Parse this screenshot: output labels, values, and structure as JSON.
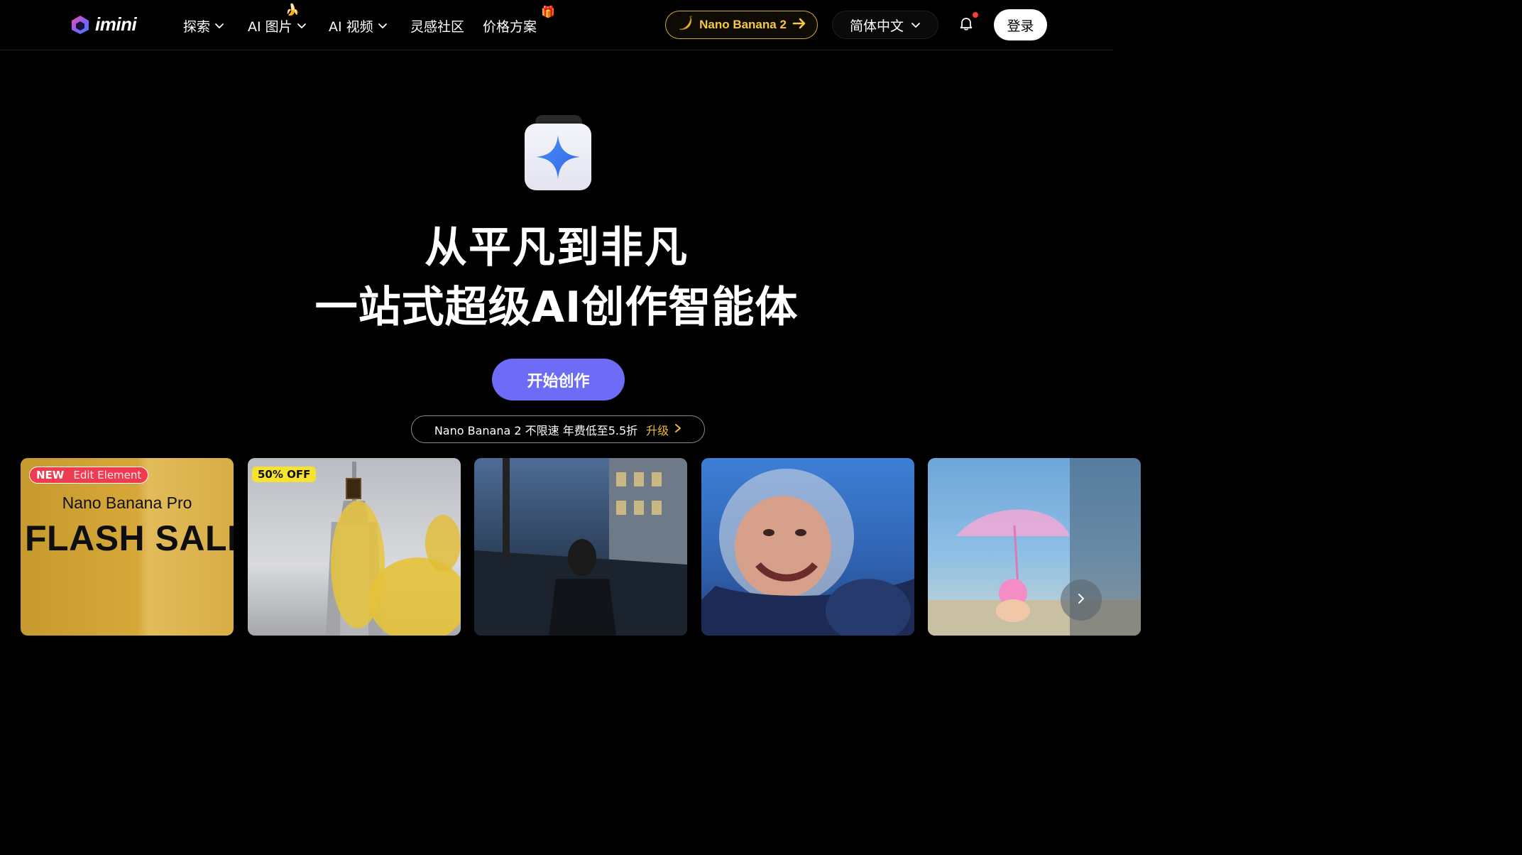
{
  "nav": {
    "logo_text": "imini",
    "items": [
      {
        "label": "探索",
        "has_dropdown": true
      },
      {
        "label": "AI 图片",
        "has_dropdown": true,
        "decoration": "🍌"
      },
      {
        "label": "AI 视频",
        "has_dropdown": true
      },
      {
        "label": "灵感社区",
        "has_dropdown": false
      },
      {
        "label": "价格方案",
        "has_dropdown": false,
        "decoration": "🎁"
      }
    ],
    "promo_button": {
      "icon": "banana-icon",
      "label": "Nano Banana 2"
    },
    "language": "简体中文",
    "login": "登录",
    "colors": {
      "promo_border": "#d7a532",
      "promo_text": "#f6c944",
      "notification_dot": "#ff3b3b"
    }
  },
  "hero": {
    "line1": "从平凡到非凡",
    "line2": "一站式超级AI创作智能体",
    "cta": "开始创作",
    "promo_text": "Nano Banana 2 不限速 年费低至5.5折",
    "promo_link": "升级",
    "colors": {
      "cta": "#6e6cf6",
      "link": "#f0b93a"
    }
  },
  "cards": [
    {
      "badge_new": "NEW",
      "badge_tag": "Edit Element",
      "subtitle": "Nano Banana Pro",
      "title": "FLASH SALE"
    },
    {
      "badge": "50% OFF"
    },
    {},
    {},
    {}
  ]
}
